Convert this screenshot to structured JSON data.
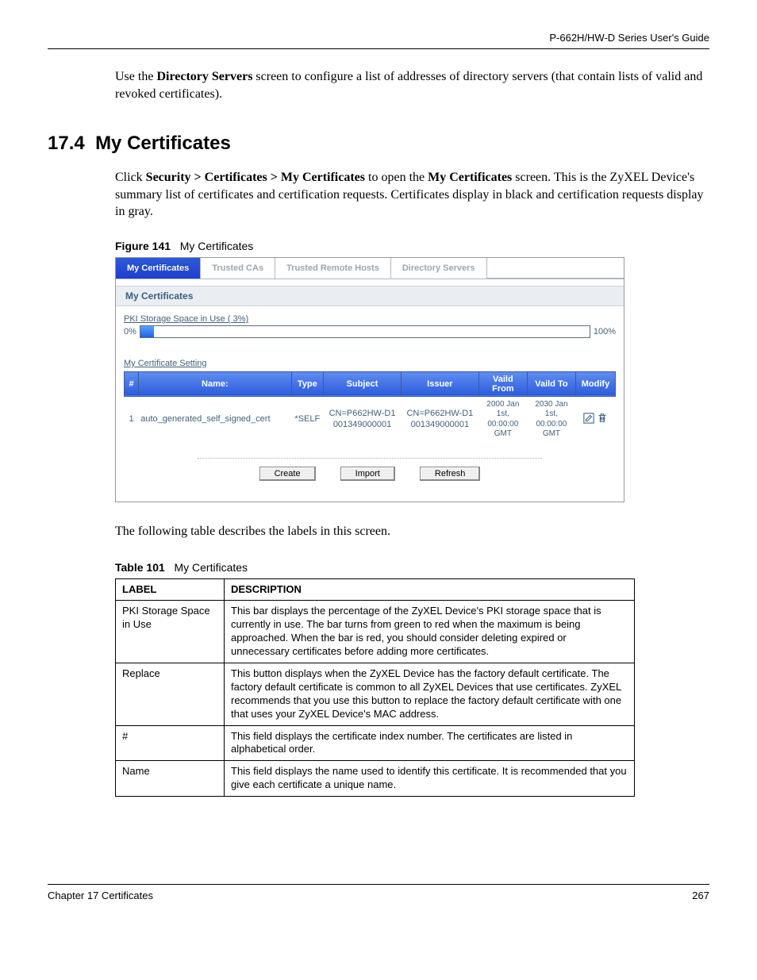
{
  "header": {
    "guide_title": "P-662H/HW-D Series User's Guide"
  },
  "intro": {
    "para1_pre": "Use the ",
    "para1_bold": "Directory Servers",
    "para1_post": " screen to configure a list of addresses of directory servers (that contain lists of valid and revoked certificates)."
  },
  "section": {
    "number": "17.4",
    "title": "My Certificates"
  },
  "click_para": {
    "pre": "Click ",
    "path": "Security > Certificates > My Certificates",
    "mid": " to open the ",
    "screen": "My Certificates",
    "post": " screen. This is the ZyXEL Device's summary list of certificates and certification requests. Certificates display in black and certification requests display in gray."
  },
  "figure": {
    "label": "Figure 141",
    "title": "My Certificates"
  },
  "ui": {
    "tabs": {
      "active": "My Certificates",
      "t2": "Trusted CAs",
      "t3": "Trusted Remote Hosts",
      "t4": "Directory Servers"
    },
    "panel_title": "My Certificates",
    "storage": {
      "label": "PKI Storage Space in Use ( 3%)",
      "min": "0%",
      "max": "100%",
      "fill_width": "3%"
    },
    "setting_label": "My Certificate Setting",
    "headers": {
      "num": "#",
      "name": "Name:",
      "type": "Type",
      "subject": "Subject",
      "issuer": "Issuer",
      "from": "Vaild From",
      "to": "Vaild To",
      "modify": "Modify"
    },
    "row": {
      "num": "1",
      "name": "auto_generated_self_signed_cert",
      "type": "*SELF",
      "subject": "CN=P662HW-D1 001349000001",
      "issuer": "CN=P662HW-D1 001349000001",
      "from": "2000 Jan 1st, 00:00:00 GMT",
      "to": "2030 Jan 1st, 00:00:00 GMT"
    },
    "buttons": {
      "create": "Create",
      "import": "Import",
      "refresh": "Refresh"
    }
  },
  "post_text": "The following table describes the labels in this screen.",
  "table": {
    "label": "Table 101",
    "title": "My Certificates",
    "head_label": "LABEL",
    "head_desc": "DESCRIPTION",
    "rows": [
      {
        "label": "PKI Storage Space in Use",
        "desc": "This bar displays the percentage of the ZyXEL Device's PKI storage space that is currently in use. The bar turns from green to red when the maximum is being approached. When the bar is red, you should consider deleting expired or unnecessary certificates before adding more certificates."
      },
      {
        "label": "Replace",
        "desc": "This button displays when the ZyXEL Device has the factory default certificate. The factory default certificate is common to all ZyXEL Devices that use certificates. ZyXEL recommends that you use this button to replace the factory default certificate with one that uses your ZyXEL Device's MAC address."
      },
      {
        "label": "#",
        "desc": "This field displays the certificate index number. The certificates are listed in alphabetical order."
      },
      {
        "label": "Name",
        "desc": "This field displays the name used to identify this certificate. It is recommended that you give each certificate a unique name."
      }
    ]
  },
  "footer": {
    "chapter": "Chapter 17 Certificates",
    "page": "267"
  }
}
